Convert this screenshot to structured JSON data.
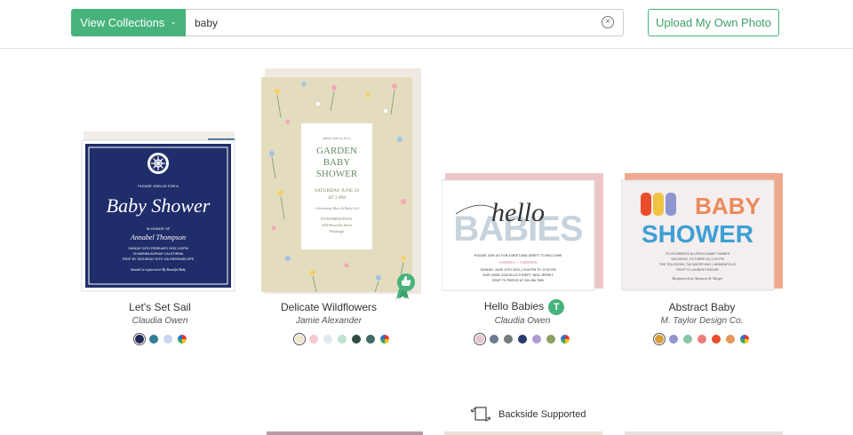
{
  "header": {
    "collections_label": "View Collections",
    "search_value": "baby",
    "upload_label": "Upload My Own Photo"
  },
  "cards": [
    {
      "title": "Let's Set Sail",
      "author": "Claudia Owen",
      "card_text": {
        "top": "PLEASE JOIN US FOR A",
        "script": "Baby Shower",
        "honor": "IN HONOR OF",
        "name": "Annabel Thompson",
        "line1": "SUNDAY 20TH FEBRUARY 2025 2:00PM",
        "line2": "39 MARINA AVENUE CALIFORNIA",
        "line3": "RSVP BY SATURDAY 20TH VIA GREENVELOPE",
        "line4": "Annabel is registered at My Beautiful Baby"
      },
      "swatches": [
        "#1f2a5a",
        "#2f7f97",
        "#c9d6f2",
        "multi"
      ]
    },
    {
      "title": "Delicate Wildflowers",
      "author": "Jamie Alexander",
      "card_text": {
        "top": "please join us for a",
        "line_a": "GARDEN",
        "line_b": "BABY",
        "line_c": "SHOWER",
        "date": "SATURDAY JUNE 20",
        "time": "AT 2 PM",
        "celebrating": "Celebrating Mary & Baby Girl",
        "place": "POINTBREEZEWAY",
        "address": "3456 Reynolds Street",
        "city": "Pittsburgh"
      },
      "swatches": [
        "#efe6cf",
        "#f3cbd0",
        "#dfe9ef",
        "#bfe3cf",
        "#2f4b44",
        "#3f6c66",
        "multi"
      ]
    },
    {
      "title": "Hello Babies",
      "author": "Claudia Owen",
      "badge": "T",
      "card_text": {
        "script": "hello",
        "big": "BABIES",
        "top": "PLEASE JOIN US FOR A MEET AND GREET TO WELCOME",
        "names": "ANDREA + ANDREW",
        "line1": "SUNDAY, JUNE 14TH 2020 | 10:00 PM TO 12:00 PM",
        "line2": "OUR HOME 2330 ELLIS STREET, NEW JERSEY",
        "line3": "RSVP TO PIERCE AT 200 456 7890"
      },
      "swatches": [
        "#e6c7cf",
        "#6c7a92",
        "#737d7a",
        "#2b3b6d",
        "#b09ad6",
        "#8ea060",
        "multi"
      ]
    },
    {
      "title": "Abstract Baby",
      "author": "M. Taylor Design Co.",
      "card_text": {
        "big1": "BABY",
        "big2": "SHOWER",
        "line1": "TO CELEBRATE ALLISON & BABY TANNER",
        "line2": "SATURDAY, OCTOBER 26 | 2:00 PM",
        "line3": "THE TEA ROOM | 740 WATER WAY | MINNEAPOLIS",
        "line4": "RSVP TO LAUREN FOWLER",
        "sig": "Registered at Amazon & Target"
      },
      "swatches": [
        "#d8a03a",
        "#8d96cf",
        "#8ac6a6",
        "#ef7c7c",
        "#ea4d2a",
        "#e8965a",
        "multi"
      ]
    }
  ],
  "backside_label": "Backside Supported"
}
